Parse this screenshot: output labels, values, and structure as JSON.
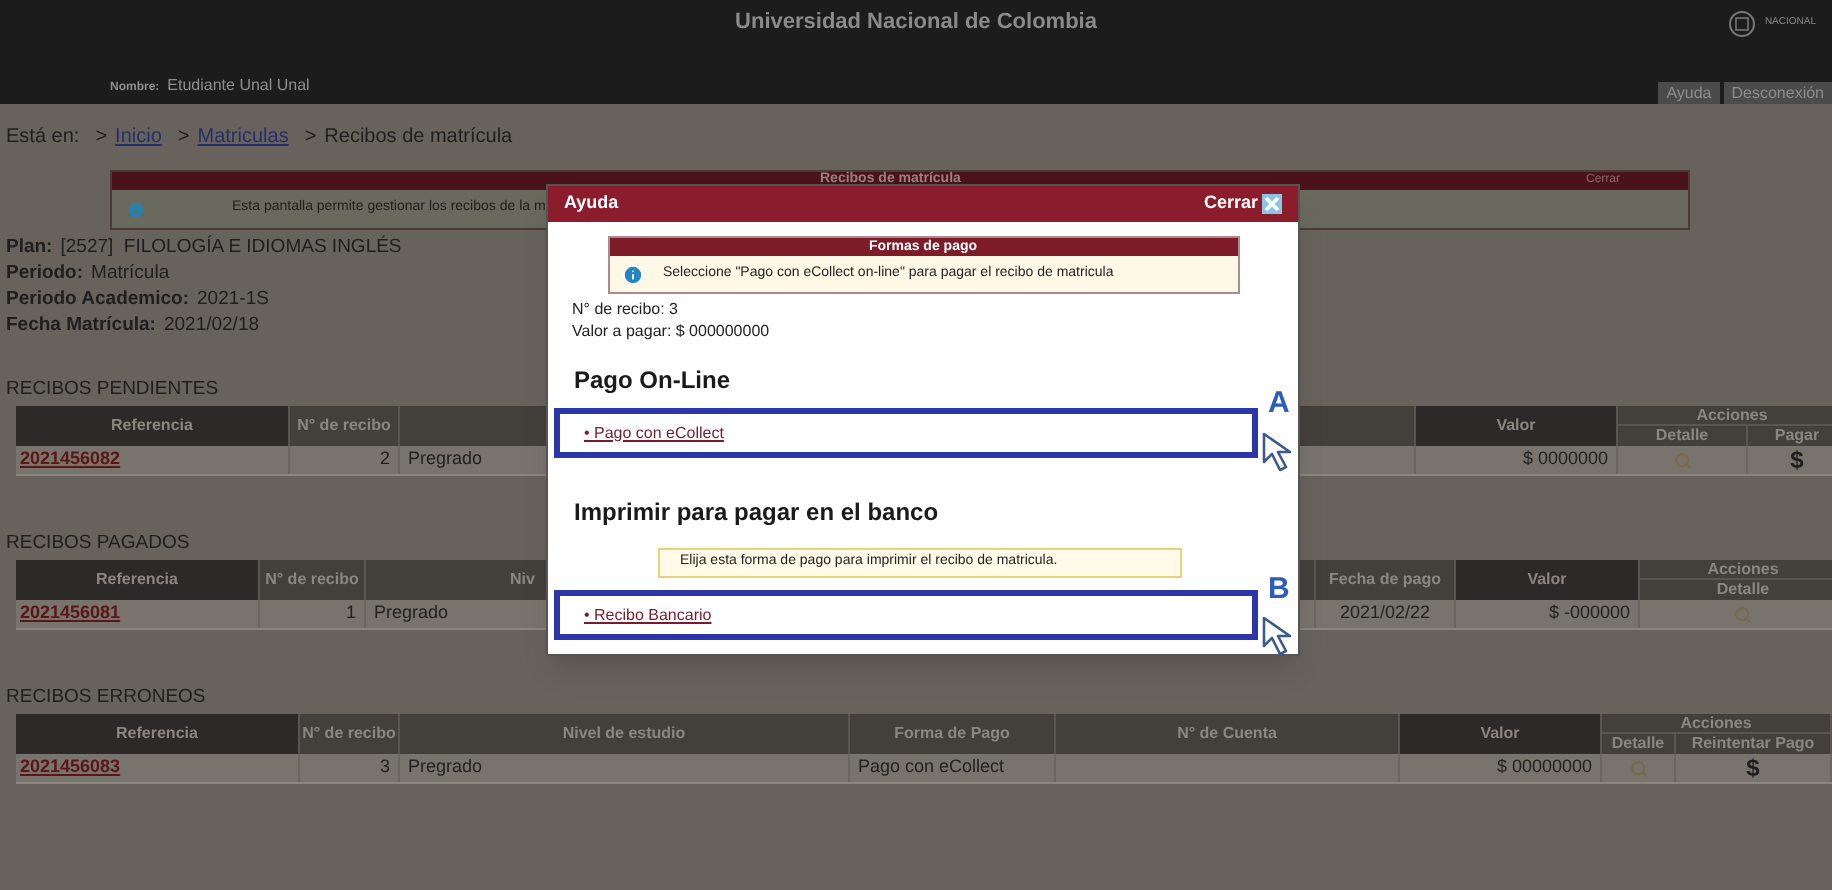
{
  "header": {
    "title": "Universidad Nacional de Colombia",
    "logo_text": "NACIONAL",
    "user_label": "Nombre:",
    "user_name": "Etudiante Unal Unal",
    "buttons": [
      "Ayuda",
      "Desconexión"
    ]
  },
  "breadcrumb": {
    "label": "Está en:",
    "items": [
      {
        "separator": ">",
        "text": "Inicio",
        "link": true
      },
      {
        "separator": ">",
        "text": "Matriculas",
        "link": true
      },
      {
        "separator": ">",
        "text": "Recibos de matrícula",
        "link": false
      }
    ]
  },
  "notice": {
    "title": "Recibos de matrícula",
    "close": "Cerrar",
    "text": "Esta pantalla permite gestionar los recibos de la m"
  },
  "info": [
    {
      "label": "Plan:",
      "value": "[2527]  FILOLOGÍA E IDIOMAS INGLÉS"
    },
    {
      "label": "Periodo:",
      "value": "Matrícula"
    },
    {
      "label": "Periodo Academico:",
      "value": "2021-1S"
    },
    {
      "label": "Fecha Matrícula:",
      "value": "2021/02/18"
    }
  ],
  "sections": [
    {
      "title": "RECIBOS PENDIENTES",
      "columns": [
        {
          "label": "Referencia"
        },
        {
          "label": "N° de recibo"
        },
        {},
        {
          "label": "Valor"
        },
        {
          "label": "Acciones",
          "sub": [
            "Detalle",
            "Pagar"
          ]
        }
      ],
      "rows": [
        [
          {
            "kind": "link",
            "text": "2021456082"
          },
          {
            "kind": "number",
            "text": "2"
          },
          {
            "kind": "text",
            "text": "Pregrado"
          },
          {
            "kind": "number",
            "text": "$ 0000000"
          },
          {
            "kind": "detail"
          },
          {
            "kind": "pay",
            "text": "$"
          }
        ]
      ]
    },
    {
      "title": "RECIBOS PAGADOS",
      "columns": [
        {
          "label": "Referencia"
        },
        {
          "label": "N° de recibo"
        },
        {
          "label": "Niv"
        },
        {
          "label": "Fecha de pago"
        },
        {
          "label": "Valor"
        },
        {
          "label": "Acciones",
          "sub": [
            "Detalle"
          ]
        }
      ],
      "rows": [
        [
          {
            "kind": "link",
            "text": "2021456081"
          },
          {
            "kind": "number",
            "text": "1"
          },
          {
            "kind": "text",
            "text": "Pregrado"
          },
          {
            "kind": "center",
            "text": "2021/02/22"
          },
          {
            "kind": "number",
            "text": "$ -000000"
          },
          {
            "kind": "detail"
          }
        ]
      ]
    },
    {
      "title": "RECIBOS ERRONEOS",
      "columns": [
        {
          "label": "Referencia"
        },
        {
          "label": "N° de recibo"
        },
        {
          "label": "Nivel de estudio"
        },
        {
          "label": "Forma de Pago"
        },
        {
          "label": "N° de Cuenta"
        },
        {
          "label": "Valor"
        },
        {
          "label": "Acciones",
          "sub": [
            "Detalle",
            "Reintentar Pago"
          ]
        }
      ],
      "rows": [
        [
          {
            "kind": "link",
            "text": "2021456083"
          },
          {
            "kind": "number",
            "text": "3"
          },
          {
            "kind": "text",
            "text": "Pregrado"
          },
          {
            "kind": "text",
            "text": "Pago con eCollect"
          },
          {
            "kind": "empty"
          },
          {
            "kind": "number",
            "text": "$ 00000000"
          },
          {
            "kind": "detail"
          },
          {
            "kind": "pay",
            "text": "$"
          }
        ]
      ]
    }
  ],
  "modal": {
    "title": "Ayuda",
    "close": "Cerrar",
    "notice": {
      "title": "Formas de pago",
      "text": "Seleccione \"Pago con eCollect on-line\" para pagar el recibo de matricula"
    },
    "lines": [
      "N° de recibo: 3",
      "Valor a pagar: $ 000000000"
    ],
    "options": [
      {
        "heading": "Pago On-Line",
        "link": "• Pago con eCollect",
        "marker": "A"
      },
      {
        "heading": "Imprimir para pagar en el banco",
        "hint": "Elija esta forma de pago para imprimir el recibo de matricula.",
        "link": "• Recibo Bancario",
        "marker": "B"
      }
    ]
  }
}
